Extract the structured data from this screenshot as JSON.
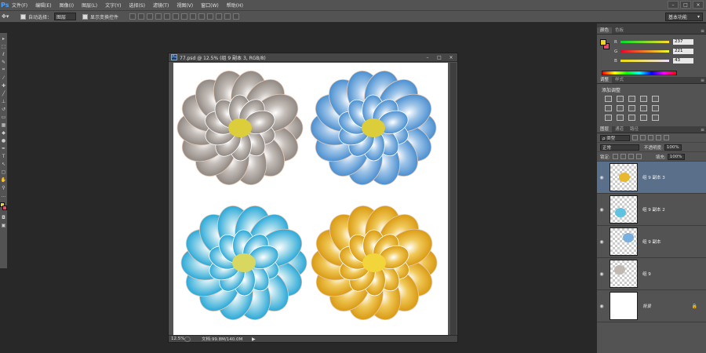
{
  "app": {
    "logo": "Ps"
  },
  "menubar": {
    "items": [
      "文件(F)",
      "编辑(E)",
      "图像(I)",
      "图层(L)",
      "文字(Y)",
      "选择(S)",
      "滤镜(T)",
      "视图(V)",
      "窗口(W)",
      "帮助(H)"
    ],
    "window_controls": [
      "–",
      "□",
      "×"
    ]
  },
  "options": {
    "tool_icon": "move-tool",
    "auto_select_label": "自动选择：",
    "auto_select_value": "图层",
    "show_transform_label": "显示变换控件",
    "workspace_value": "基本功能"
  },
  "document": {
    "title": "77.psd @ 12.5% (组 9 副本 3, RGB/8)",
    "zoom": "12.5%",
    "doc_info": "文档:99.8M/140.0M",
    "controls": [
      "–",
      "□",
      "×"
    ],
    "peonies": [
      {
        "petal": "#c2bbb6",
        "dark": "#8f8883",
        "center": "#dccd3a"
      },
      {
        "petal": "#9ec4e8",
        "dark": "#4a8fd0",
        "center": "#dccd3a"
      },
      {
        "petal": "#9ed8ea",
        "dark": "#2aa8d8",
        "center": "#d8d860"
      },
      {
        "petal": "#f0c858",
        "dark": "#d99a12",
        "center": "#f2d53a"
      }
    ]
  },
  "color_panel": {
    "tabs": [
      "颜色",
      "色板"
    ],
    "channels": [
      {
        "label": "R",
        "value": "237"
      },
      {
        "label": "G",
        "value": "221"
      },
      {
        "label": "B",
        "value": "43"
      }
    ]
  },
  "adjustments_panel": {
    "tabs": [
      "调整",
      "样式"
    ],
    "title": "添加调整"
  },
  "layers_panel": {
    "tabs": [
      "图层",
      "通道",
      "路径"
    ],
    "filter_label": "ρ 类型",
    "blend_mode": "正常",
    "opacity_label": "不透明度:",
    "opacity_value": "100%",
    "lock_label": "锁定:",
    "fill_label": "填充:",
    "fill_value": "100%",
    "layers": [
      {
        "name": "组 9 副本 3",
        "selected": true,
        "color": "#e8b830"
      },
      {
        "name": "组 9 副本 2",
        "selected": false,
        "color": "#5ec2e0"
      },
      {
        "name": "组 9 副本",
        "selected": false,
        "color": "#7ab0e0"
      },
      {
        "name": "组 9",
        "selected": false,
        "color": "#c0b8b2"
      },
      {
        "name": "背景",
        "selected": false,
        "color": "#ffffff"
      }
    ]
  },
  "colors": {
    "foreground": "#edd52b",
    "background": "#e54b6a",
    "selection": "#5a6f8a"
  }
}
